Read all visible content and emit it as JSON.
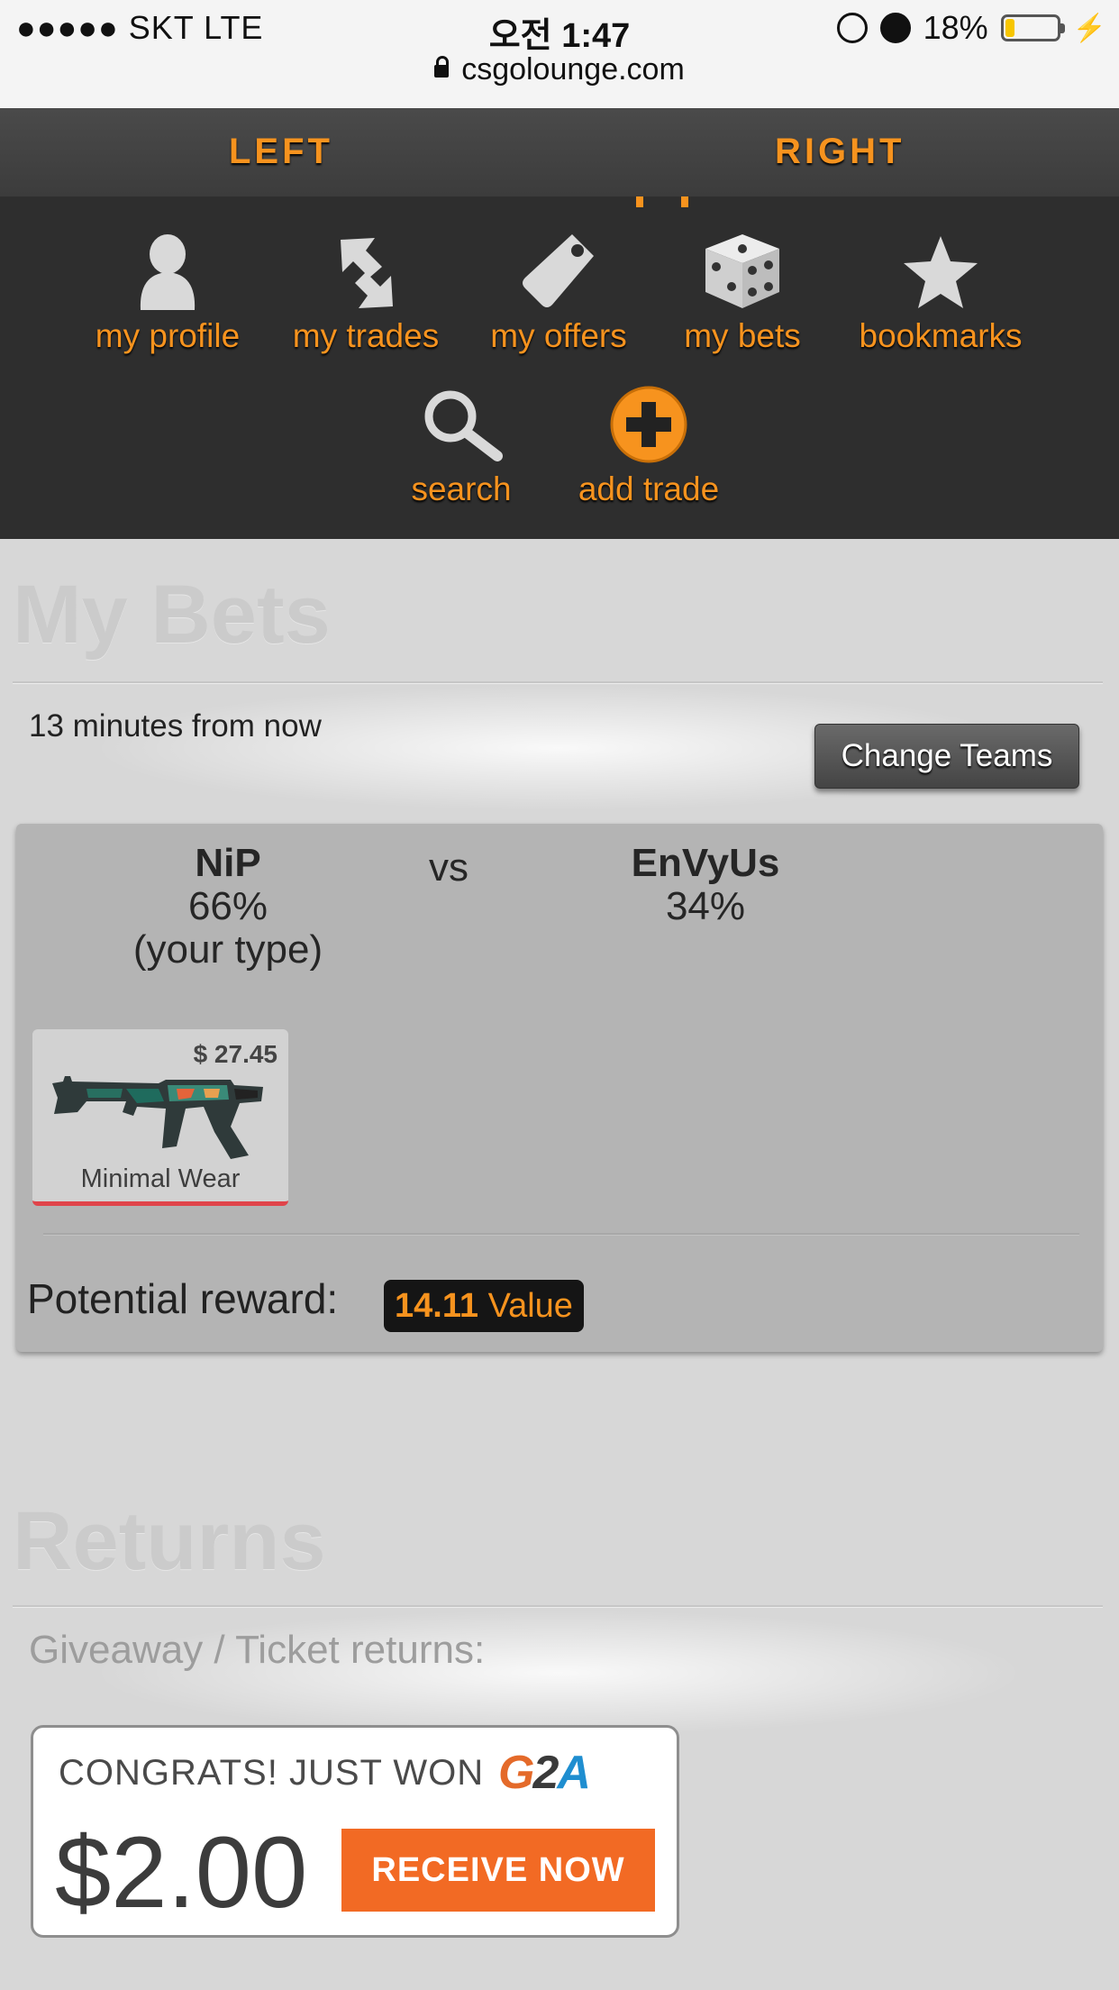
{
  "status_bar": {
    "carrier": "●●●●● SKT   LTE",
    "time": "오전 1:47",
    "battery": "18%",
    "battery_level": 0.18,
    "url": "csgolounge.com"
  },
  "top_bar": {
    "left": "LEFT",
    "right": "RIGHT"
  },
  "nav": {
    "items": [
      {
        "label": "my profile",
        "icon": "user-icon"
      },
      {
        "label": "my trades",
        "icon": "trade-arrows-icon"
      },
      {
        "label": "my offers",
        "icon": "tag-icon"
      },
      {
        "label": "my bets",
        "icon": "dice-icon"
      },
      {
        "label": "bookmarks",
        "icon": "star-icon"
      },
      {
        "label": "search",
        "icon": "search-icon"
      },
      {
        "label": "add trade",
        "icon": "plus-circle-icon"
      }
    ]
  },
  "my_bets": {
    "heading": "My Bets",
    "time": "13 minutes from now",
    "change_teams": "Change Teams",
    "team1": {
      "name": "NiP",
      "percent": "66%",
      "note": "(your type)"
    },
    "vs": "vs",
    "team2": {
      "name": "EnVyUs",
      "percent": "34%"
    },
    "item": {
      "price": "$ 27.45",
      "wear": "Minimal Wear",
      "icon": "ak47-skin-icon"
    },
    "potential_reward_label": "Potential reward:",
    "reward_value": "14.11",
    "reward_unit": "Value"
  },
  "returns": {
    "heading": "Returns",
    "description": "Giveaway / Ticket returns:"
  },
  "ad": {
    "congrats": "CONGRATS! JUST WON",
    "logo": "G2A",
    "amount": "$2.00",
    "button": "RECEIVE NOW"
  },
  "colors": {
    "accent": "#f7931e",
    "nav_bg": "#2e2e2e",
    "card_bg": "#b4b4b4",
    "ad_button": "#f26a24"
  }
}
